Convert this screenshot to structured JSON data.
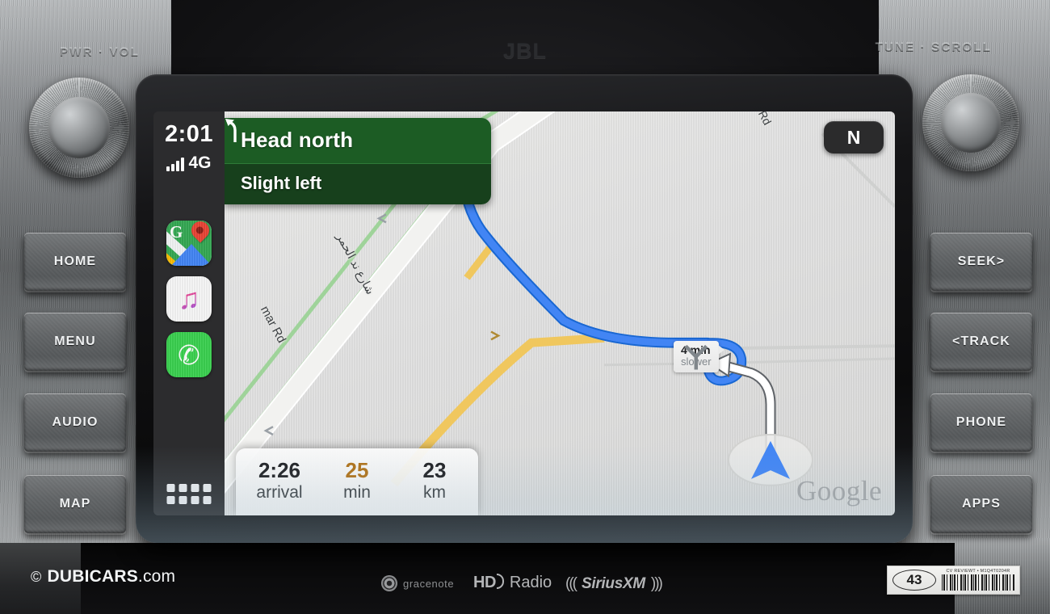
{
  "dashboard": {
    "brand_badge": "JBL",
    "knob_left_label": "PWR · VOL",
    "knob_right_label": "TUNE · SCROLL",
    "left_buttons": [
      {
        "label": "HOME",
        "name": "home"
      },
      {
        "label": "MENU",
        "name": "menu"
      },
      {
        "label": "AUDIO",
        "name": "audio"
      },
      {
        "label": "MAP",
        "name": "map"
      }
    ],
    "right_buttons": [
      {
        "label": "SEEK>",
        "name": "seek"
      },
      {
        "label": "<TRACK",
        "name": "track"
      },
      {
        "label": "PHONE",
        "name": "phone"
      },
      {
        "label": "APPS",
        "name": "apps"
      }
    ],
    "logos": {
      "gracenote": "gracenote",
      "hd": "HD",
      "hd_radio": "Radio",
      "siriusxm": "SiriusXM",
      "siriusxm_left_waves": "(((",
      "siriusxm_right_waves": ")))"
    },
    "sticker": {
      "number": "43",
      "code_text": "CV REVIEWT • M1Q4T0204R"
    },
    "watermark": {
      "copyright": "©",
      "brand": "DUBICARS",
      "tld": ".com"
    }
  },
  "carplay": {
    "status": {
      "clock": "2:01",
      "network": "4G",
      "signal_bars": 4
    },
    "dock": {
      "apps": [
        {
          "name": "google-maps",
          "label": "Maps",
          "glyph": "G"
        },
        {
          "name": "apple-music",
          "label": "Music",
          "glyph": "♫"
        },
        {
          "name": "phone",
          "label": "Phone",
          "glyph": "✆"
        }
      ],
      "grid_button_label": "All Apps"
    }
  },
  "navigation": {
    "banner": {
      "primary": "Head north",
      "secondary": "Slight left",
      "maneuver_icon": "slight-left-arrow-icon",
      "primary_bg": "#1c5c24",
      "secondary_bg": "#17401c"
    },
    "compass": {
      "heading_letter": "N"
    },
    "eta": [
      {
        "value": "2:26",
        "unit": "arrival",
        "accent": false
      },
      {
        "value": "25",
        "unit": "min",
        "accent": true
      },
      {
        "value": "23",
        "unit": "km",
        "accent": false
      }
    ],
    "eta_accent_color": "#b07219",
    "alt_route_tag": {
      "line1": "4 min",
      "line2": "slower",
      "icon": "fork-road-icon"
    },
    "attribution": "Google",
    "road_labels": [
      {
        "name": "nad-al-hamar-rd",
        "text": "mar Rd"
      },
      {
        "name": "nad-al-hamar-rd-arabic",
        "text": "شارع ند الحمر"
      },
      {
        "name": "top-road",
        "text": "Rd"
      }
    ],
    "route_color": "#4285f4",
    "arterial_color": "#f7d774"
  }
}
